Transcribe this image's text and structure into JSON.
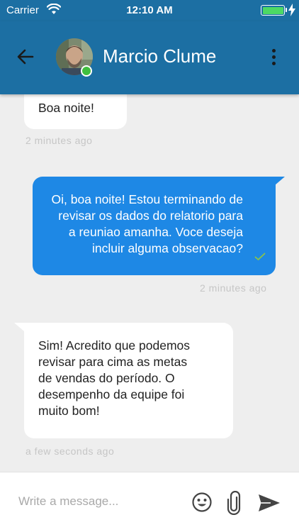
{
  "status_bar": {
    "carrier": "Carrier",
    "time": "12:10 AM",
    "battery_level": 1.0,
    "charging": true
  },
  "header": {
    "contact_name": "Marcio Clume",
    "online": true,
    "bar_color": "#1c6fa3"
  },
  "messages": [
    {
      "direction": "incoming",
      "lines": [
        "Boa noite!"
      ],
      "meta": "2 minutes ago"
    },
    {
      "direction": "outgoing",
      "lines": [
        "Oi, boa noite! Estou terminando de",
        "revisar os dados do relatorio para",
        "a reuniao amanha. Voce deseja",
        "incluir alguma observacao?"
      ],
      "status_icon": "check-icon",
      "meta": "2 minutes ago"
    },
    {
      "direction": "incoming",
      "lines": [
        "Sim! Acredito que podemos",
        "revisar para cima as metas",
        "de vendas do período. O",
        "desempenho da equipe foi",
        "muito bom!"
      ],
      "meta": "a few seconds ago"
    }
  ],
  "composer": {
    "placeholder": "Write a message...",
    "value": "",
    "icons": [
      "emoji-icon",
      "paperclip-icon",
      "send-icon"
    ]
  },
  "colors": {
    "outgoing_bubble": "#1e88e5",
    "incoming_bubble": "#ffffff",
    "chat_background": "#eeeeee",
    "online": "#3fbf3f",
    "read_check": "#8bc34a"
  }
}
